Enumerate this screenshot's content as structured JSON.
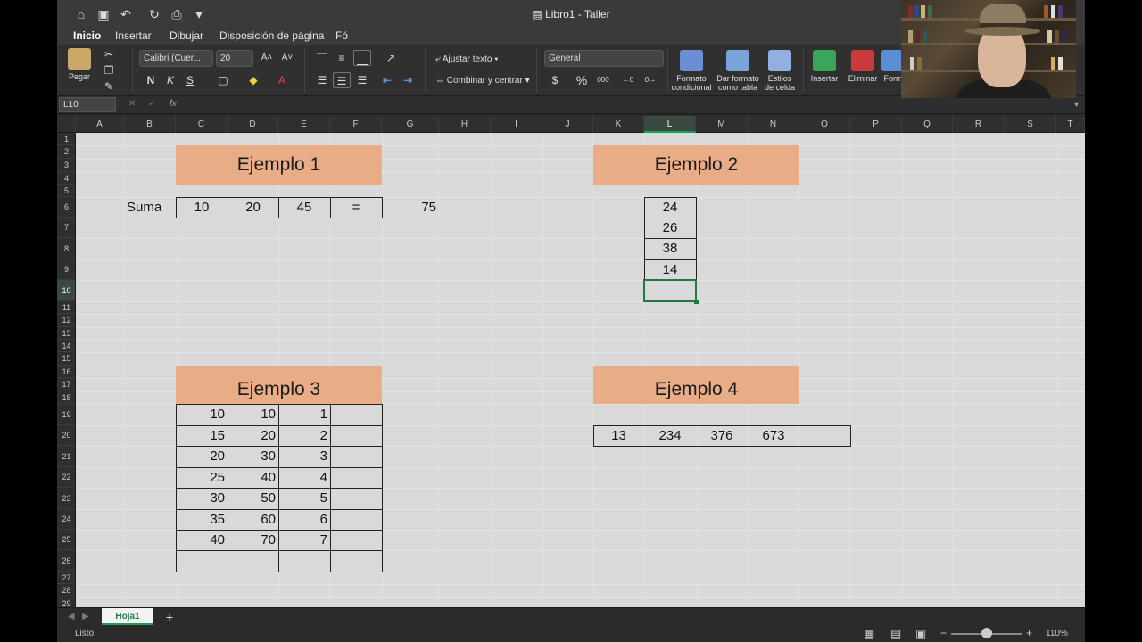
{
  "window": {
    "title": "Libro1 - Taller"
  },
  "ribbon_tabs": [
    "Inicio",
    "Insertar",
    "Dibujar",
    "Disposición de página",
    "Fó"
  ],
  "ribbon": {
    "paste_label": "Pegar",
    "font_name": "Calibri (Cuer...",
    "font_size": "20",
    "wrap_text": "Ajustar texto",
    "merge_center": "Combinar y centrar",
    "number_format": "General",
    "cond_format_1": "Formato",
    "cond_format_2": "condicional",
    "format_table_1": "Dar formato",
    "format_table_2": "como tabla",
    "cell_styles_1": "Estilos",
    "cell_styles_2": "de celda",
    "insert_label": "Insertar",
    "delete_label": "Eliminar",
    "format_label": "Form",
    "bold": "N",
    "italic": "K",
    "underline": "S",
    "currency": "$",
    "percent": "%",
    "thousands": "000"
  },
  "formula_bar": {
    "name_box": "L10",
    "fx": "fx",
    "formula": ""
  },
  "columns": [
    "A",
    "B",
    "C",
    "D",
    "E",
    "F",
    "G",
    "H",
    "I",
    "J",
    "K",
    "L",
    "M",
    "N",
    "O",
    "P",
    "Q",
    "R",
    "S",
    "T"
  ],
  "rows": [
    "1",
    "2",
    "3",
    "4",
    "5",
    "6",
    "7",
    "8",
    "9",
    "10",
    "11",
    "12",
    "13",
    "14",
    "15",
    "16",
    "17",
    "18",
    "19",
    "20",
    "21",
    "22",
    "23",
    "24",
    "25",
    "26",
    "27",
    "28",
    "29"
  ],
  "selected_cell": {
    "column": "L",
    "row": "10"
  },
  "sheet": {
    "ejemplo1": {
      "title": "Ejemplo 1",
      "label": "Suma",
      "values": [
        "10",
        "20",
        "45",
        "="
      ],
      "result": "75"
    },
    "ejemplo2": {
      "title": "Ejemplo 2",
      "values": [
        "24",
        "26",
        "38",
        "14"
      ]
    },
    "ejemplo3": {
      "title": "Ejemplo 3",
      "rows": [
        [
          "10",
          "10",
          "1"
        ],
        [
          "15",
          "20",
          "2"
        ],
        [
          "20",
          "30",
          "3"
        ],
        [
          "25",
          "40",
          "4"
        ],
        [
          "30",
          "50",
          "5"
        ],
        [
          "35",
          "60",
          "6"
        ],
        [
          "40",
          "70",
          "7"
        ]
      ]
    },
    "ejemplo4": {
      "title": "Ejemplo 4",
      "values": [
        "13",
        "234",
        "376",
        "673"
      ]
    },
    "banner_color": "#e8ad87"
  },
  "sheet_tabs": {
    "active": "Hoja1",
    "add": "+"
  },
  "status": {
    "text": "Listo",
    "zoom": "110%",
    "zoom_minus": "−",
    "zoom_plus": "+"
  },
  "colors": {
    "accent": "#1f9d55",
    "selection": "#1f7a45"
  }
}
